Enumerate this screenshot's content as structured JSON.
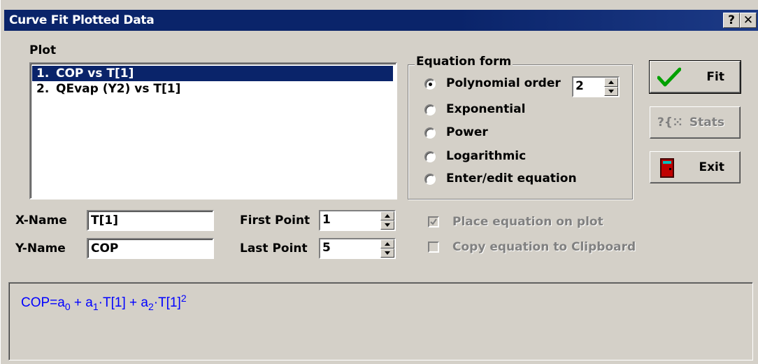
{
  "window": {
    "title": "Curve Fit Plotted Data",
    "help_btn": "?",
    "close_btn": "✕"
  },
  "plot": {
    "label": "Plot",
    "items": [
      {
        "num": "1.",
        "text": "COP vs T[1]",
        "selected": true
      },
      {
        "num": "2.",
        "text": "QEvap (Y2) vs T[1]",
        "selected": false
      }
    ]
  },
  "equation_form": {
    "title": "Equation form",
    "options": [
      {
        "label": "Polynomial order",
        "checked": true
      },
      {
        "label": "Exponential",
        "checked": false
      },
      {
        "label": "Power",
        "checked": false
      },
      {
        "label": "Logarithmic",
        "checked": false
      },
      {
        "label": "Enter/edit equation",
        "checked": false
      }
    ],
    "polynomial_order": "2"
  },
  "buttons": {
    "fit": "Fit",
    "stats": "Stats",
    "stats_icon": "?{⁙",
    "exit": "Exit",
    "fit_icon": "checkmark-icon",
    "exit_icon": "door-icon"
  },
  "names": {
    "x_label": "X-Name",
    "x_value": "T[1]",
    "y_label": "Y-Name",
    "y_value": "COP"
  },
  "points": {
    "first_label": "First Point",
    "first_value": "1",
    "last_label": "Last Point",
    "last_value": "5"
  },
  "options": {
    "place_equation": "Place equation on plot",
    "place_checked": true,
    "copy_equation": "Copy equation to Clipboard",
    "copy_checked": false
  },
  "equation": {
    "lhs": "COP=a",
    "s0": "0",
    "t1": " + a",
    "s1": "1",
    "t2": "·T[1] + a",
    "s2": "2",
    "t3": "·T[1]",
    "sup": "2"
  },
  "colors": {
    "title_bg": "#0a246a",
    "equation_text": "#0000ff",
    "dialog_bg": "#d4d0c8",
    "fit_check": "#00a000"
  }
}
